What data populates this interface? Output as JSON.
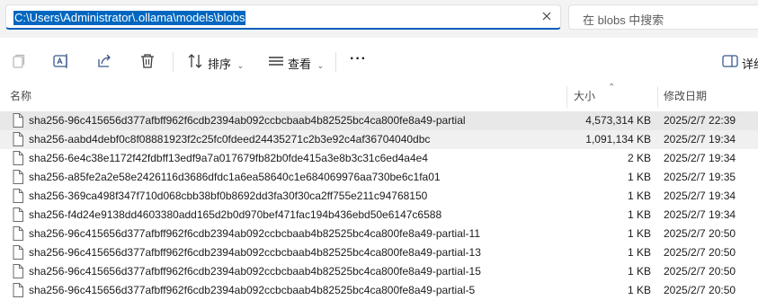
{
  "address_bar": {
    "path": "C:\\Users\\Administrator\\.ollama\\models\\blobs",
    "clear_icon": "close-icon"
  },
  "search": {
    "placeholder": "在 blobs 中搜索"
  },
  "command_bar": {
    "copy_icon": "copy-icon",
    "rename_icon": "rename-icon",
    "share_icon": "share-icon",
    "delete_icon": "delete-icon",
    "sort_label": "排序",
    "view_label": "查看",
    "more_label": "···",
    "details_label": "详细"
  },
  "columns": {
    "name": "名称",
    "size": "大小",
    "modified": "修改日期"
  },
  "files": [
    {
      "name": "sha256-96c415656d377afbff962f6cdb2394ab092ccbcbaab4b82525bc4ca800fe8a49-partial",
      "size": "4,573,314 KB",
      "date": "2025/2/7 22:39"
    },
    {
      "name": "sha256-aabd4debf0c8f08881923f2c25fc0fdeed24435271c2b3e92c4af36704040dbc",
      "size": "1,091,134 KB",
      "date": "2025/2/7 19:34"
    },
    {
      "name": "sha256-6e4c38e1172f42fdbff13edf9a7a017679fb82b0fde415a3e8b3c31c6ed4a4e4",
      "size": "2 KB",
      "date": "2025/2/7 19:34"
    },
    {
      "name": "sha256-a85fe2a2e58e2426116d3686dfdc1a6ea58640c1e684069976aa730be6c1fa01",
      "size": "1 KB",
      "date": "2025/2/7 19:35"
    },
    {
      "name": "sha256-369ca498f347f710d068cbb38bf0b8692dd3fa30f30ca2ff755e211c94768150",
      "size": "1 KB",
      "date": "2025/2/7 19:34"
    },
    {
      "name": "sha256-f4d24e9138dd4603380add165d2b0d970bef471fac194b436ebd50e6147c6588",
      "size": "1 KB",
      "date": "2025/2/7 19:34"
    },
    {
      "name": "sha256-96c415656d377afbff962f6cdb2394ab092ccbcbaab4b82525bc4ca800fe8a49-partial-11",
      "size": "1 KB",
      "date": "2025/2/7 20:50"
    },
    {
      "name": "sha256-96c415656d377afbff962f6cdb2394ab092ccbcbaab4b82525bc4ca800fe8a49-partial-13",
      "size": "1 KB",
      "date": "2025/2/7 20:50"
    },
    {
      "name": "sha256-96c415656d377afbff962f6cdb2394ab092ccbcbaab4b82525bc4ca800fe8a49-partial-15",
      "size": "1 KB",
      "date": "2025/2/7 20:50"
    },
    {
      "name": "sha256-96c415656d377afbff962f6cdb2394ab092ccbcbaab4b82525bc4ca800fe8a49-partial-5",
      "size": "1 KB",
      "date": "2025/2/7 20:50"
    }
  ],
  "colors": {
    "selection_highlight": "#0067c0",
    "accent": "#005fb8",
    "row_selected": "#e8e8e8"
  }
}
